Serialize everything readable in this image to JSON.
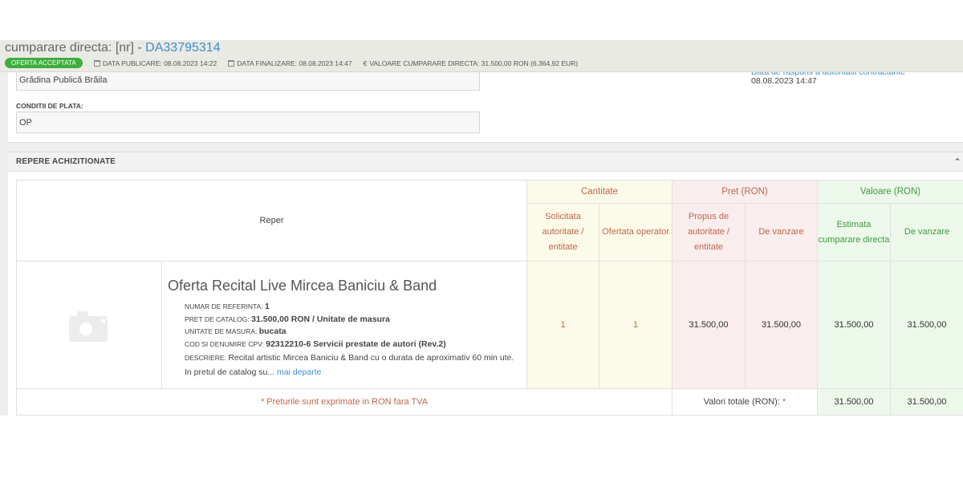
{
  "header": {
    "title_prefix": "cumparare directa: [nr] - ",
    "code": "DA33795314",
    "status_badge": "OFERTA ACCEPTATA",
    "data_publicare": "DATA PUBLICARE: 08.08.2023 14:22",
    "data_finalizare": "DATA FINALIZARE: 08.08.2023 14:47",
    "valoare": "VALOARE CUMPARARE DIRECTA: 31.500,00  RON (6.364,92  EUR)"
  },
  "upper": {
    "location_value": "Grădina Publică Brăila",
    "payment_label": "CONDITII DE PLATA:",
    "payment_value": "OP",
    "right_label": "Data de raspuns a autoritatii contractante",
    "right_date": "08.08.2023 14:47"
  },
  "panel": {
    "title": "REPERE ACHIZITIONATE",
    "headers": {
      "reper": "Reper",
      "cantitate": "Cantitate",
      "pret": "Pret (RON)",
      "valoare": "Valoare (RON)",
      "solicitata": "Solicitata autoritate / entitate",
      "ofertata": "Ofertata operator",
      "propus": "Propus de autoritate / entitate",
      "de_vanzare_pret": "De vanzare",
      "estimata": "Estimata cumparare directa",
      "de_vanzare_val": "De vanzare"
    },
    "item": {
      "title": "Oferta Recital Live Mircea Baniciu & Band",
      "ref_label": "NUMAR DE REFERINTA: ",
      "ref_value": "1",
      "catalog_label": "PRET DE CATALOG: ",
      "catalog_value": "31.500,00  RON / Unitate de masura",
      "um_label": "UNITATE DE MASURA: ",
      "um_value": "bucata",
      "cpv_label": "COD SI DENUMIRE CPV: ",
      "cpv_value": "92312210-6 Servicii prestate de autori (Rev.2)",
      "desc_label": "DESCRIERE: ",
      "desc_value": "Recital artistic Mircea Baniciu & Band cu o durata de aproximativ 60 min ute. In pretul de catalog su...",
      "more": "mai departe",
      "solicitata": "1",
      "ofertata": "1",
      "propus": "31.500,00",
      "pret_vanzare": "31.500,00",
      "estimata": "31.500,00",
      "val_vanzare": "31.500,00"
    },
    "footer": {
      "note": "* Preturile sunt exprimate in RON fara TVA",
      "totals_label": "Valori totale (RON): ",
      "totals_star": "*",
      "total_estimata": "31.500,00",
      "total_vanzare": "31.500,00"
    }
  }
}
